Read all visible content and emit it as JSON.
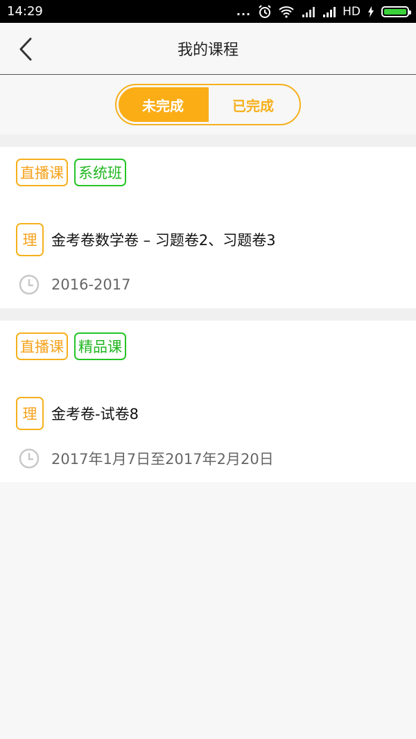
{
  "status": {
    "time": "14:29",
    "dots": "...",
    "network": "HD"
  },
  "header": {
    "title": "我的课程"
  },
  "tabs": [
    {
      "label": "未完成",
      "active": true
    },
    {
      "label": "已完成",
      "active": false
    }
  ],
  "courses": [
    {
      "badges": [
        {
          "label": "直播课",
          "color": "#f6b01c"
        },
        {
          "label": "系统班",
          "color": "#25c425"
        }
      ],
      "subject": "理",
      "title": "金考卷数学卷 – 习题卷2、习题卷3",
      "time": "2016-2017"
    },
    {
      "badges": [
        {
          "label": "直播课",
          "color": "#f6b01c"
        },
        {
          "label": "精品课",
          "color": "#25c425"
        }
      ],
      "subject": "理",
      "title": "金考卷-试卷8",
      "time": "2017年1月7日至2017年2月20日"
    }
  ],
  "colors": {
    "accent": "#fbad15",
    "green": "#25c425"
  }
}
